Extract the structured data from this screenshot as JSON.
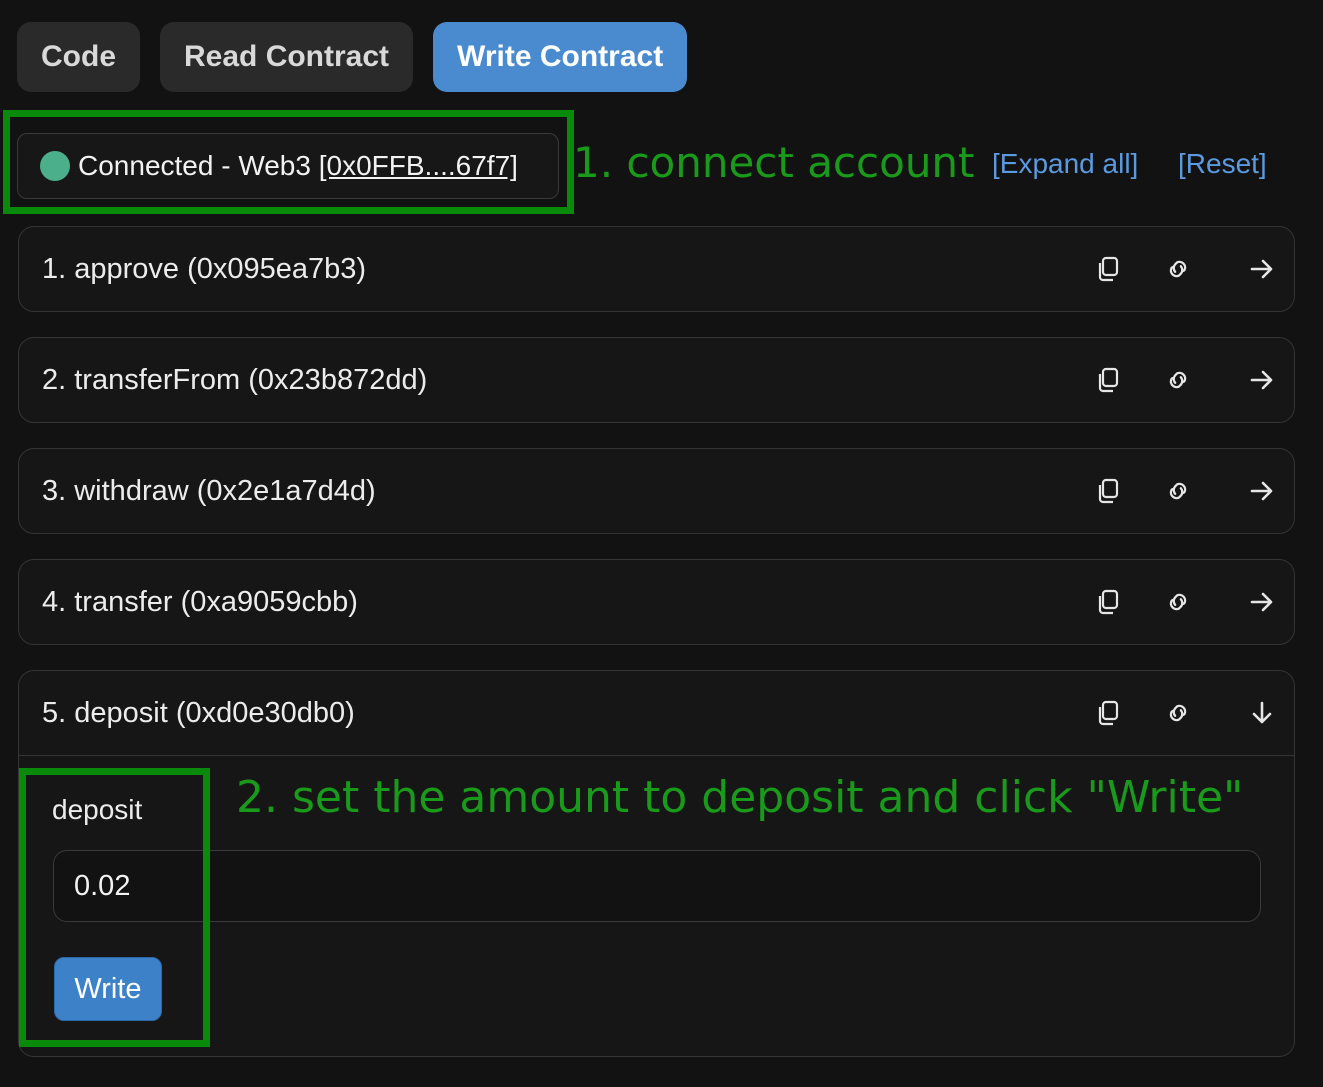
{
  "tabs": [
    {
      "label": "Code",
      "active": false
    },
    {
      "label": "Read Contract",
      "active": false
    },
    {
      "label": "Write Contract",
      "active": true
    }
  ],
  "connection": {
    "status_text": "Connected - Web3 ",
    "address": "[0x0FFB....67f7]",
    "status_color": "#4caf8c"
  },
  "annotations": {
    "step1": "1. connect account",
    "step2": "2. set the amount to deposit and click \"Write\""
  },
  "links": {
    "expand_all": "[Expand all]",
    "reset": "[Reset]"
  },
  "functions": [
    {
      "title": "1. approve (0x095ea7b3)",
      "expanded": false
    },
    {
      "title": "2. transferFrom (0x23b872dd)",
      "expanded": false
    },
    {
      "title": "3. withdraw (0x2e1a7d4d)",
      "expanded": false
    },
    {
      "title": "4. transfer (0xa9059cbb)",
      "expanded": false
    },
    {
      "title": "5. deposit (0xd0e30db0)",
      "expanded": true
    }
  ],
  "deposit_form": {
    "param_label": "deposit",
    "amount_value": "0.02",
    "write_label": "Write"
  },
  "colors": {
    "accent": "#4a8bd0",
    "link": "#5b9ae0",
    "annotation": "#1a9a1a",
    "background": "#121212"
  }
}
